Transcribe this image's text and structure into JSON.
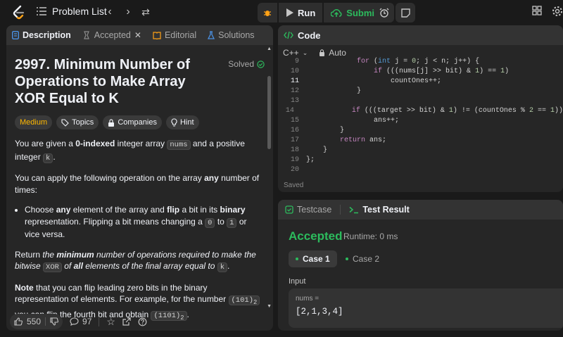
{
  "topbar": {
    "problem_list": "Problem List",
    "run": "Run",
    "submit": "Submit"
  },
  "description": {
    "tabs": [
      {
        "label": "Description"
      },
      {
        "label": "Accepted"
      },
      {
        "label": "Editorial"
      },
      {
        "label": "Solutions"
      }
    ],
    "title": "2997. Minimum Number of Operations to Make Array XOR Equal to K",
    "solved": "Solved",
    "chips": {
      "difficulty": "Medium",
      "topics": "Topics",
      "companies": "Companies",
      "hint": "Hint"
    },
    "p1": {
      "a": "You are given a ",
      "b": "0-indexed",
      "c": " integer array ",
      "d": "nums",
      "e": " and a positive integer ",
      "f": "k",
      "g": "."
    },
    "p2": {
      "a": "You can apply the following operation on the array ",
      "b": "any",
      "c": " number of times:"
    },
    "bullet": {
      "a": "Choose ",
      "b": "any",
      "c": " element of the array and ",
      "d": "flip",
      "e": " a bit in its ",
      "f": "binary",
      "g": " representation. Flipping a bit means changing a ",
      "h": "0",
      "i": " to ",
      "j": "1",
      "k": " or vice versa."
    },
    "p3": {
      "a": "Return ",
      "b": "the ",
      "c": "minimum",
      "d": " number of operations required to make the bitwise ",
      "e": "XOR",
      "f": " of ",
      "g": "all",
      "h": " elements of the final array equal to ",
      "i": "k",
      "j": "."
    },
    "p4": {
      "a": "Note",
      "b": " that you can flip leading zero bits in the binary representation of elements. For example, for the number ",
      "c": "(101)",
      "d": "2",
      "e": " you can flip the fourth bit and obtain ",
      "f": "(1101)",
      "g": "2",
      "h": "."
    },
    "footer": {
      "likes": "550",
      "comments": "97"
    }
  },
  "code": {
    "header": "Code",
    "language": "C++",
    "mode": "Auto",
    "saved": "Saved",
    "lines": [
      {
        "n": "9",
        "t": "            for (int j = 0; j < n; j++) {"
      },
      {
        "n": "10",
        "t": "                if (((nums[j] >> bit) & 1) == 1)"
      },
      {
        "n": "11",
        "t": "                    countOnes++;"
      },
      {
        "n": "12",
        "t": "            }"
      },
      {
        "n": "13",
        "t": ""
      },
      {
        "n": "14",
        "t": "            if (((target >> bit) & 1) != (countOnes % 2 == 1))"
      },
      {
        "n": "15",
        "t": "                ans++;"
      },
      {
        "n": "16",
        "t": "        }"
      },
      {
        "n": "17",
        "t": "        return ans;"
      },
      {
        "n": "18",
        "t": "    }"
      },
      {
        "n": "19",
        "t": "};"
      },
      {
        "n": "20",
        "t": ""
      }
    ]
  },
  "result": {
    "tab_testcase": "Testcase",
    "tab_result": "Test Result",
    "status": "Accepted",
    "runtime": "Runtime: 0 ms",
    "case1": "Case 1",
    "case2": "Case 2",
    "input_label": "Input",
    "var_name": "nums =",
    "var_value": "[2,1,3,4]"
  },
  "colors": {
    "accent_green": "#2cbb5d",
    "medium": "#ffb800",
    "panel": "#262626",
    "bg": "#1a1a1a"
  }
}
